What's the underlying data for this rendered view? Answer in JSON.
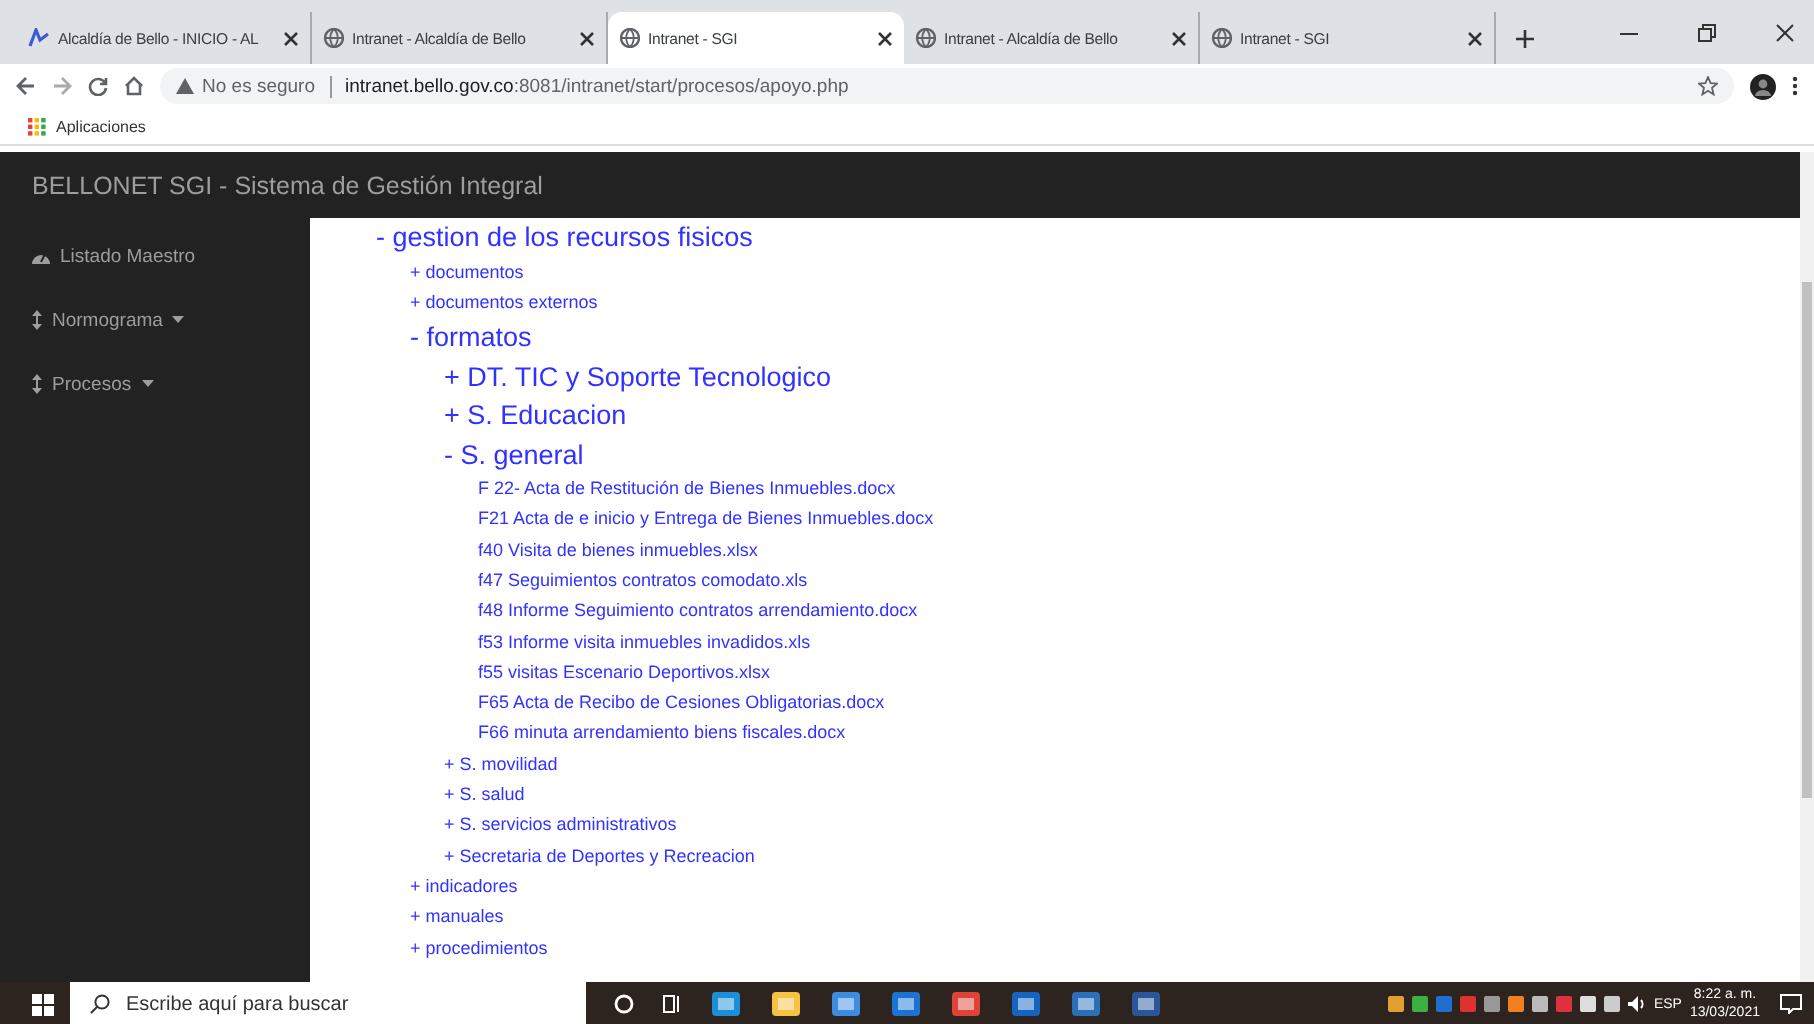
{
  "browser": {
    "tabs": [
      {
        "title": "Alcaldía de Bello - INICIO - AL",
        "selected": false
      },
      {
        "title": "Intranet - Alcaldía de Bello",
        "selected": false
      },
      {
        "title": "Intranet - SGI",
        "selected": true
      },
      {
        "title": "Intranet - Alcaldía de Bello",
        "selected": false
      },
      {
        "title": "Intranet - SGI",
        "selected": false
      }
    ],
    "security": "No es seguro",
    "url_host": "intranet.bello.gov.co",
    "url_rest": ":8081/intranet/start/procesos/apoyo.php",
    "bookmarks": [
      "Aplicaciones"
    ]
  },
  "page": {
    "title": "BELLONET SGI - Sistema de Gestión Integral",
    "sidebar": {
      "items": [
        {
          "label": "Listado Maestro",
          "kind": "dashboard",
          "has_menu": false
        },
        {
          "label": "Normograma",
          "kind": "sort",
          "has_menu": true
        },
        {
          "label": "Procesos",
          "kind": "sort",
          "has_menu": true
        }
      ]
    },
    "tree": [
      {
        "label": "- gestion de los recursos fisicos",
        "kind": "section",
        "children": [
          {
            "label": "+ documentos",
            "kind": "item"
          },
          {
            "label": "+ documentos externos",
            "kind": "item"
          },
          {
            "label": "- formatos",
            "kind": "section",
            "children": [
              {
                "label": "+ DT. TIC y Soporte Tecnologico",
                "kind": "section"
              },
              {
                "label": "+ S. Educacion",
                "kind": "section"
              },
              {
                "label": "- S. general",
                "kind": "section",
                "children": [
                  {
                    "label": "F 22- Acta de Restitución de Bienes Inmuebles.docx",
                    "kind": "item"
                  },
                  {
                    "label": "F21 Acta de e inicio y Entrega de Bienes Inmuebles.docx",
                    "kind": "item"
                  },
                  {
                    "label": "f40 Visita de bienes inmuebles.xlsx",
                    "kind": "item"
                  },
                  {
                    "label": "f47 Seguimientos contratos comodato.xls",
                    "kind": "item"
                  },
                  {
                    "label": "f48 Informe Seguimiento contratos arrendamiento.docx",
                    "kind": "item"
                  },
                  {
                    "label": "f53 Informe visita inmuebles invadidos.xls",
                    "kind": "item"
                  },
                  {
                    "label": "f55 visitas Escenario Deportivos.xlsx",
                    "kind": "item"
                  },
                  {
                    "label": "F65 Acta de Recibo de Cesiones Obligatorias.docx",
                    "kind": "item"
                  },
                  {
                    "label": "F66 minuta arrendamiento biens fiscales.docx",
                    "kind": "item"
                  }
                ]
              },
              {
                "label": "+ S. movilidad",
                "kind": "item"
              },
              {
                "label": "+ S. salud",
                "kind": "item"
              },
              {
                "label": "+ S. servicios administrativos",
                "kind": "item"
              },
              {
                "label": "+ Secretaria de Deportes y Recreacion",
                "kind": "item"
              }
            ]
          },
          {
            "label": "+ indicadores",
            "kind": "item"
          },
          {
            "label": "+ manuales",
            "kind": "item"
          },
          {
            "label": "+ procedimientos",
            "kind": "item"
          }
        ]
      }
    ]
  },
  "taskbar": {
    "search_placeholder": "Escribe aquí para buscar",
    "language": "ESP",
    "time": "8:22 a. m.",
    "date": "13/03/2021"
  }
}
